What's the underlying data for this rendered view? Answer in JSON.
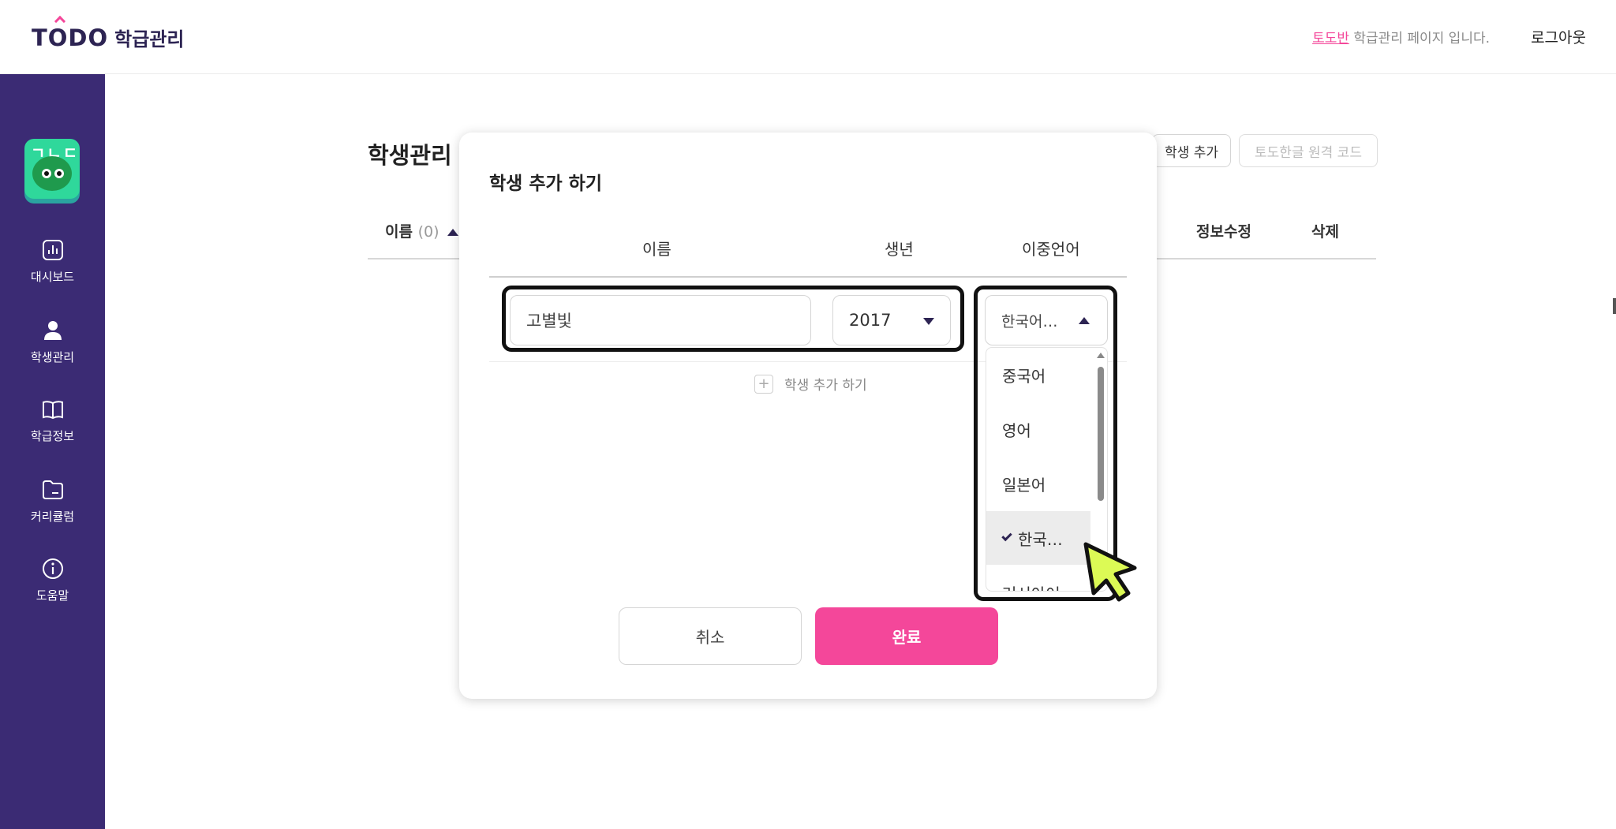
{
  "header": {
    "logo_text": "TODO",
    "logo_sub": "학급관리",
    "class_name": "토도반",
    "page_message": " 학급관리 페이지 입니다.",
    "logout": "로그아웃"
  },
  "sidebar": {
    "mascot_text": "ㄱㄴㄷ",
    "items": [
      {
        "label": "대시보드",
        "icon": "chart-icon"
      },
      {
        "label": "학생관리",
        "icon": "user-icon"
      },
      {
        "label": "학급정보",
        "icon": "book-icon"
      },
      {
        "label": "커리큘럼",
        "icon": "folder-icon"
      },
      {
        "label": "도움말",
        "icon": "info-icon"
      }
    ]
  },
  "main": {
    "title": "학생관리",
    "add_student_button": "학생 추가",
    "remote_code_button": "토도한글 원격 코드",
    "table_headers": {
      "name": "이름",
      "count": "(0)",
      "edit": "정보수정",
      "delete": "삭제"
    }
  },
  "modal": {
    "title": "학생 추가 하기",
    "columns": {
      "name": "이름",
      "birth_year": "생년",
      "bilingual": "이중언어"
    },
    "row": {
      "name_value": "고별빛",
      "year_value": "2017",
      "language_value": "한국어…"
    },
    "dropdown_options": [
      {
        "label": "중국어",
        "selected": false
      },
      {
        "label": "영어",
        "selected": false
      },
      {
        "label": "일본어",
        "selected": false
      },
      {
        "label": "한국…",
        "selected": true
      },
      {
        "label": "러시아어",
        "selected": false
      }
    ],
    "add_row_label": "학생 추가 하기",
    "cancel_label": "취소",
    "done_label": "완료"
  },
  "colors": {
    "brand_purple": "#3b2b74",
    "accent_pink": "#f4479a",
    "cursor_yellow": "#dcfa55"
  }
}
